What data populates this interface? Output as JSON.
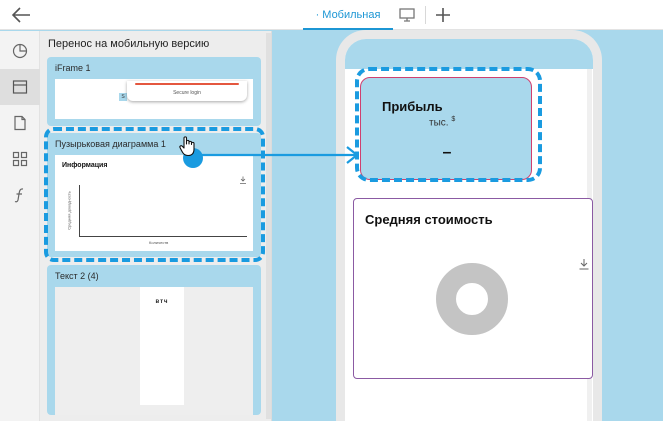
{
  "topbar": {
    "tab_mobile": "· Мобильная",
    "icons": [
      "arrow-left-icon",
      "monitor-icon",
      "plus-icon"
    ]
  },
  "rail": {
    "icons": [
      "pie-chart-icon",
      "layout-icon",
      "document-icon",
      "grid-icon",
      "function-icon"
    ],
    "active_index": 1
  },
  "panel": {
    "title": "Перенос на мобильную версию",
    "cards": [
      {
        "title": "iFrame 1",
        "preview_text": "Secure login",
        "tag": "S"
      },
      {
        "title": "Пузырьковая диаграмма 1",
        "heading": "Информация",
        "y_label": "Средняя доходность",
        "x_label": "Количеств"
      },
      {
        "title": "Текст 2 (4)",
        "body_text": "втч"
      }
    ]
  },
  "phone": {
    "profit": {
      "title": "Прибыль",
      "unit": "тыс.",
      "currency": "$",
      "value": "–"
    },
    "avg": {
      "title": "Средняя стоимость"
    }
  },
  "colors": {
    "accent": "#1a9be0",
    "widget_bg": "#a9d8ec",
    "profit_border": "#d0406f",
    "avg_border": "#8b5aa3",
    "iframe_line": "#e4573f",
    "donut": "#c4c4c4"
  }
}
